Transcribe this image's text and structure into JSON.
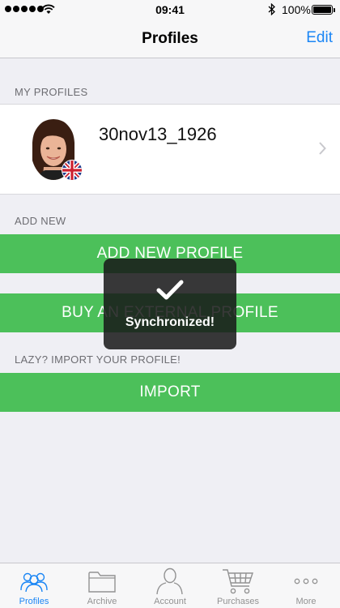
{
  "status_bar": {
    "time": "09:41",
    "battery": "100%"
  },
  "nav": {
    "title": "Profiles",
    "edit_label": "Edit"
  },
  "my_profiles": {
    "header": "MY PROFILES",
    "items": [
      {
        "name": "30nov13_1926",
        "flag": "uk-flag-icon"
      }
    ]
  },
  "add_new": {
    "header": "ADD NEW",
    "add_profile_label": "ADD NEW PROFILE",
    "buy_external_label": "BUY AN EXTERNAL PROFILE"
  },
  "import_section": {
    "header": "LAZY? IMPORT YOUR PROFILE!",
    "import_label": "IMPORT"
  },
  "hud": {
    "message": "Synchronized!",
    "icon": "checkmark-icon"
  },
  "tabs": [
    {
      "label": "Profiles",
      "icon": "profiles-icon",
      "active": true
    },
    {
      "label": "Archive",
      "icon": "folder-icon",
      "active": false
    },
    {
      "label": "Account",
      "icon": "person-icon",
      "active": false
    },
    {
      "label": "Purchases",
      "icon": "cart-icon",
      "active": false
    },
    {
      "label": "More",
      "icon": "more-icon",
      "active": false
    }
  ],
  "colors": {
    "accent": "#1b86f5",
    "button_green": "#4cc05a",
    "background": "#efeff4"
  }
}
